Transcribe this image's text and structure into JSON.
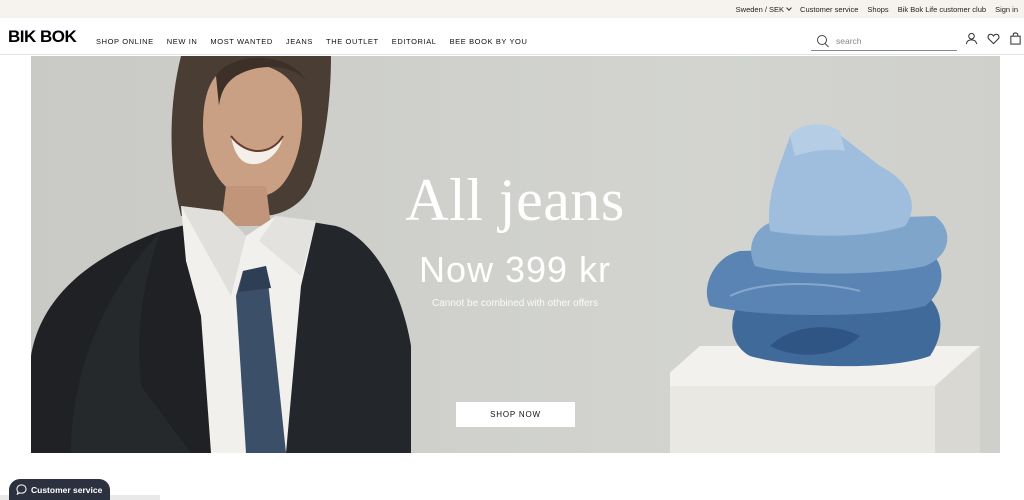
{
  "utility": {
    "region": "Sweden / SEK",
    "customer_service": "Customer service",
    "shops": "Shops",
    "club": "Bik Bok Life customer club",
    "sign_in": "Sign in"
  },
  "header": {
    "logo": "BIK BOK",
    "nav": [
      "SHOP ONLINE",
      "NEW IN",
      "MOST WANTED",
      "JEANS",
      "THE OUTLET",
      "EDITORIAL",
      "BEE BOOK BY YOU"
    ],
    "search_placeholder": "search"
  },
  "hero": {
    "title": "All jeans",
    "subtitle": "Now 399 kr",
    "note": "Cannot be combined with other offers",
    "cta": "SHOP NOW"
  },
  "chat": {
    "label": "Customer service"
  },
  "colors": {
    "utility_bg": "#f6f3ee",
    "hero_bg": "#cfd0cc",
    "chat_bg": "#2c3140"
  }
}
